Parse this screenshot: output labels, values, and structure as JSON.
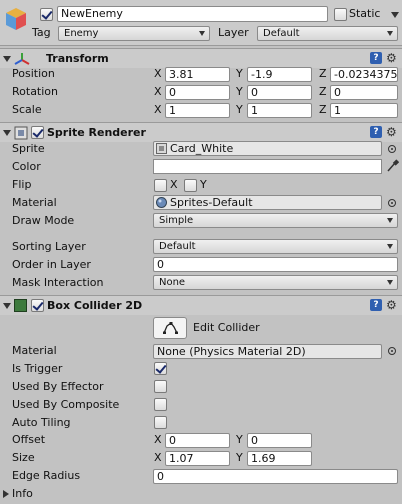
{
  "header": {
    "object_active": true,
    "object_name": "NewEnemy",
    "static_label": "Static",
    "static_checked": false,
    "tag_label": "Tag",
    "tag_value": "Enemy",
    "layer_label": "Layer",
    "layer_value": "Default"
  },
  "transform": {
    "title": "Transform",
    "position_label": "Position",
    "rotation_label": "Rotation",
    "scale_label": "Scale",
    "position": {
      "x": "3.81",
      "y": "-1.9",
      "z": "-0.0234375"
    },
    "rotation": {
      "x": "0",
      "y": "0",
      "z": "0"
    },
    "scale": {
      "x": "1",
      "y": "1",
      "z": "1"
    },
    "axis_x": "X",
    "axis_y": "Y",
    "axis_z": "Z"
  },
  "sprite_renderer": {
    "title": "Sprite Renderer",
    "enabled": true,
    "sprite_label": "Sprite",
    "sprite_value": "Card_White",
    "color_label": "Color",
    "color_value": "#ffffff",
    "flip_label": "Flip",
    "flip_x": "X",
    "flip_y": "Y",
    "material_label": "Material",
    "material_value": "Sprites-Default",
    "draw_mode_label": "Draw Mode",
    "draw_mode_value": "Simple",
    "sorting_layer_label": "Sorting Layer",
    "sorting_layer_value": "Default",
    "order_in_layer_label": "Order in Layer",
    "order_in_layer_value": "0",
    "mask_interaction_label": "Mask Interaction",
    "mask_interaction_value": "None"
  },
  "box_collider": {
    "title": "Box Collider 2D",
    "enabled": true,
    "edit_collider_label": "Edit Collider",
    "material_label": "Material",
    "material_value": "None (Physics Material 2D)",
    "is_trigger_label": "Is Trigger",
    "is_trigger": true,
    "used_by_effector_label": "Used By Effector",
    "used_by_effector": false,
    "used_by_composite_label": "Used By Composite",
    "used_by_composite": false,
    "auto_tiling_label": "Auto Tiling",
    "auto_tiling": false,
    "offset_label": "Offset",
    "offset": {
      "x": "0",
      "y": "0"
    },
    "size_label": "Size",
    "size": {
      "x": "1.07",
      "y": "1.69"
    },
    "edge_radius_label": "Edge Radius",
    "edge_radius_value": "0",
    "info_label": "Info"
  },
  "colors": {
    "panel_bg": "#c2c2c2",
    "header_bg": "#cbcbcb",
    "help_icon": "#2f5fb0"
  }
}
